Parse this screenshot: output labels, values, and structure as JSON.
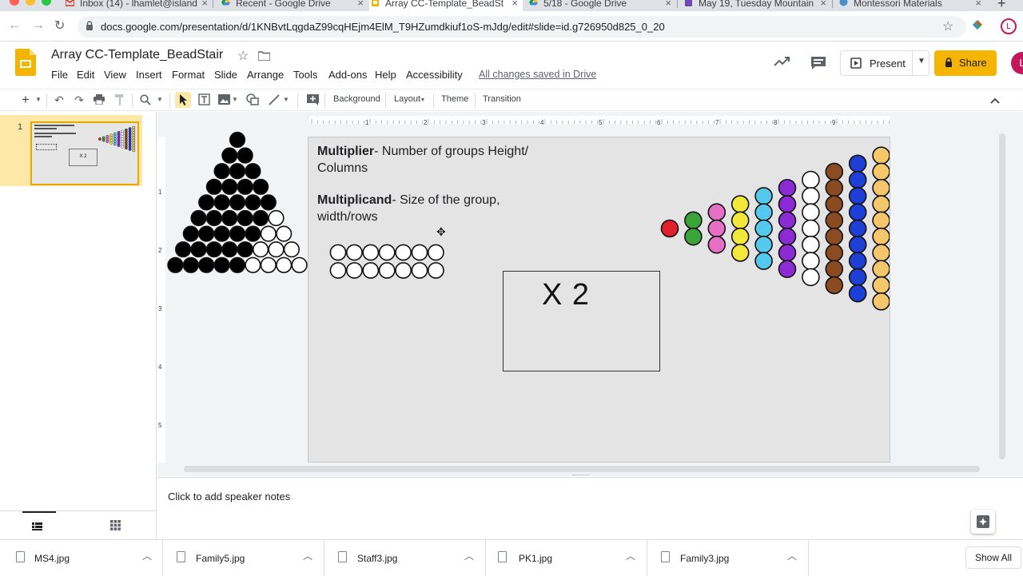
{
  "browser": {
    "tabs": [
      {
        "label": "Inbox (14) - lhamlet@island",
        "icon": "gmail-icon"
      },
      {
        "label": "Recent - Google Drive",
        "icon": "google-drive-icon"
      },
      {
        "label": "Array CC-Template_BeadSt",
        "icon": "google-slides-icon",
        "active": true
      },
      {
        "label": "5/18 - Google Drive",
        "icon": "google-drive-icon"
      },
      {
        "label": "May 19, Tuesday Mountain",
        "icon": "google-forms-icon"
      },
      {
        "label": "Montessori Materials",
        "icon": "site-icon"
      }
    ],
    "url": "docs.google.com/presentation/d/1KNBvtLqgdaZ99cqHEjm4ElM_T9HZumdkiuf1oS-mJdg/edit#slide=id.g726950d825_0_20"
  },
  "doc": {
    "title": "Array CC-Template_BeadStair",
    "menu": [
      "File",
      "Edit",
      "View",
      "Insert",
      "Format",
      "Slide",
      "Arrange",
      "Tools",
      "Add-ons",
      "Help",
      "Accessibility"
    ],
    "saved_status": "All changes saved in Drive",
    "present_label": "Present",
    "share_label": "Share",
    "avatar_letter": "L"
  },
  "toolbar": {
    "background_label": "Background",
    "layout_label": "Layout",
    "theme_label": "Theme",
    "transition_label": "Transition"
  },
  "ruler": {
    "top_ticks": [
      "1",
      "2",
      "3",
      "4",
      "5",
      "6",
      "7",
      "8",
      "9"
    ],
    "left_ticks": [
      "1",
      "2",
      "3",
      "4",
      "5"
    ]
  },
  "filmstrip": {
    "slide_number": "1"
  },
  "slide": {
    "multiplier_bold": "Multiplier",
    "multiplier_text": "- Number of groups Height/ Columns",
    "multiplicand_bold": "Multiplicand",
    "multiplicand_text": "- Size of the group, width/rows",
    "box_text": "X 2",
    "bead_colors": [
      "#e0202a",
      "#3aa43a",
      "#e86fc6",
      "#f2e83a",
      "#55c8ee",
      "#8c2bd6",
      "#ffffff",
      "#8a4b20",
      "#1e3fd6",
      "#f5c66a"
    ],
    "bead_counts": [
      1,
      2,
      3,
      4,
      5,
      6,
      7,
      8,
      9,
      10
    ]
  },
  "notes": {
    "placeholder": "Click to add speaker notes"
  },
  "downloads": {
    "files": [
      "MS4.jpg",
      "Family5.jpg",
      "Staff3.jpg",
      "PK1.jpg",
      "Family3.jpg"
    ],
    "show_all": "Show All"
  }
}
